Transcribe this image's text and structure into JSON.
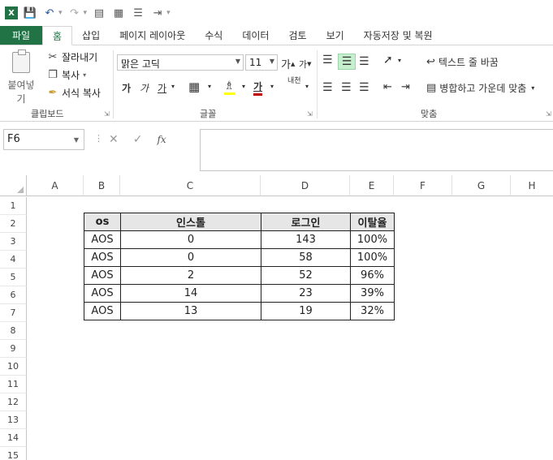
{
  "qat": {
    "excel_logo": "X",
    "icons": [
      "save-icon",
      "undo-icon",
      "redo-icon",
      "format-painter-icon",
      "form-icon",
      "align-icon",
      "indent-icon",
      "customize-icon"
    ]
  },
  "tabs": [
    "파일",
    "홈",
    "삽입",
    "페이지 레이아웃",
    "수식",
    "데이터",
    "검토",
    "보기",
    "자동저장 및 복원"
  ],
  "active_tab": "홈",
  "ribbon": {
    "clipboard": {
      "paste": "붙여넣기",
      "cut": "잘라내기",
      "copy": "복사",
      "format_painter": "서식 복사",
      "group": "클립보드"
    },
    "font": {
      "name": "맑은 고딕",
      "size": "11",
      "bold": "가",
      "italic": "가",
      "underline": "가",
      "group": "글꼴",
      "grow": "가",
      "shrink": "가",
      "phonetic": "내천"
    },
    "alignment": {
      "wrap_text": "텍스트 줄 바꿈",
      "merge_center": "병합하고 가운데 맞춤",
      "group": "맞춤"
    }
  },
  "formula_bar": {
    "name_box": "F6",
    "cancel": "✕",
    "enter": "✓",
    "fx": "fx",
    "content": ""
  },
  "grid": {
    "columns": [
      "A",
      "B",
      "C",
      "D",
      "E",
      "F",
      "G",
      "H"
    ],
    "rows": [
      "1",
      "2",
      "3",
      "4",
      "5",
      "6",
      "7",
      "8",
      "9",
      "10",
      "11",
      "12",
      "13",
      "14",
      "15"
    ]
  },
  "table": {
    "headers": [
      "os",
      "인스톨",
      "로그인",
      "이탈율"
    ],
    "rows": [
      [
        "AOS",
        "0",
        "143",
        "100%"
      ],
      [
        "AOS",
        "0",
        "58",
        "100%"
      ],
      [
        "AOS",
        "2",
        "52",
        "96%"
      ],
      [
        "AOS",
        "14",
        "23",
        "39%"
      ],
      [
        "AOS",
        "13",
        "19",
        "32%"
      ]
    ]
  },
  "colors": {
    "excel_green": "#217346",
    "header_fill": "#e7e6e6",
    "align_selected": "#c6efce"
  }
}
